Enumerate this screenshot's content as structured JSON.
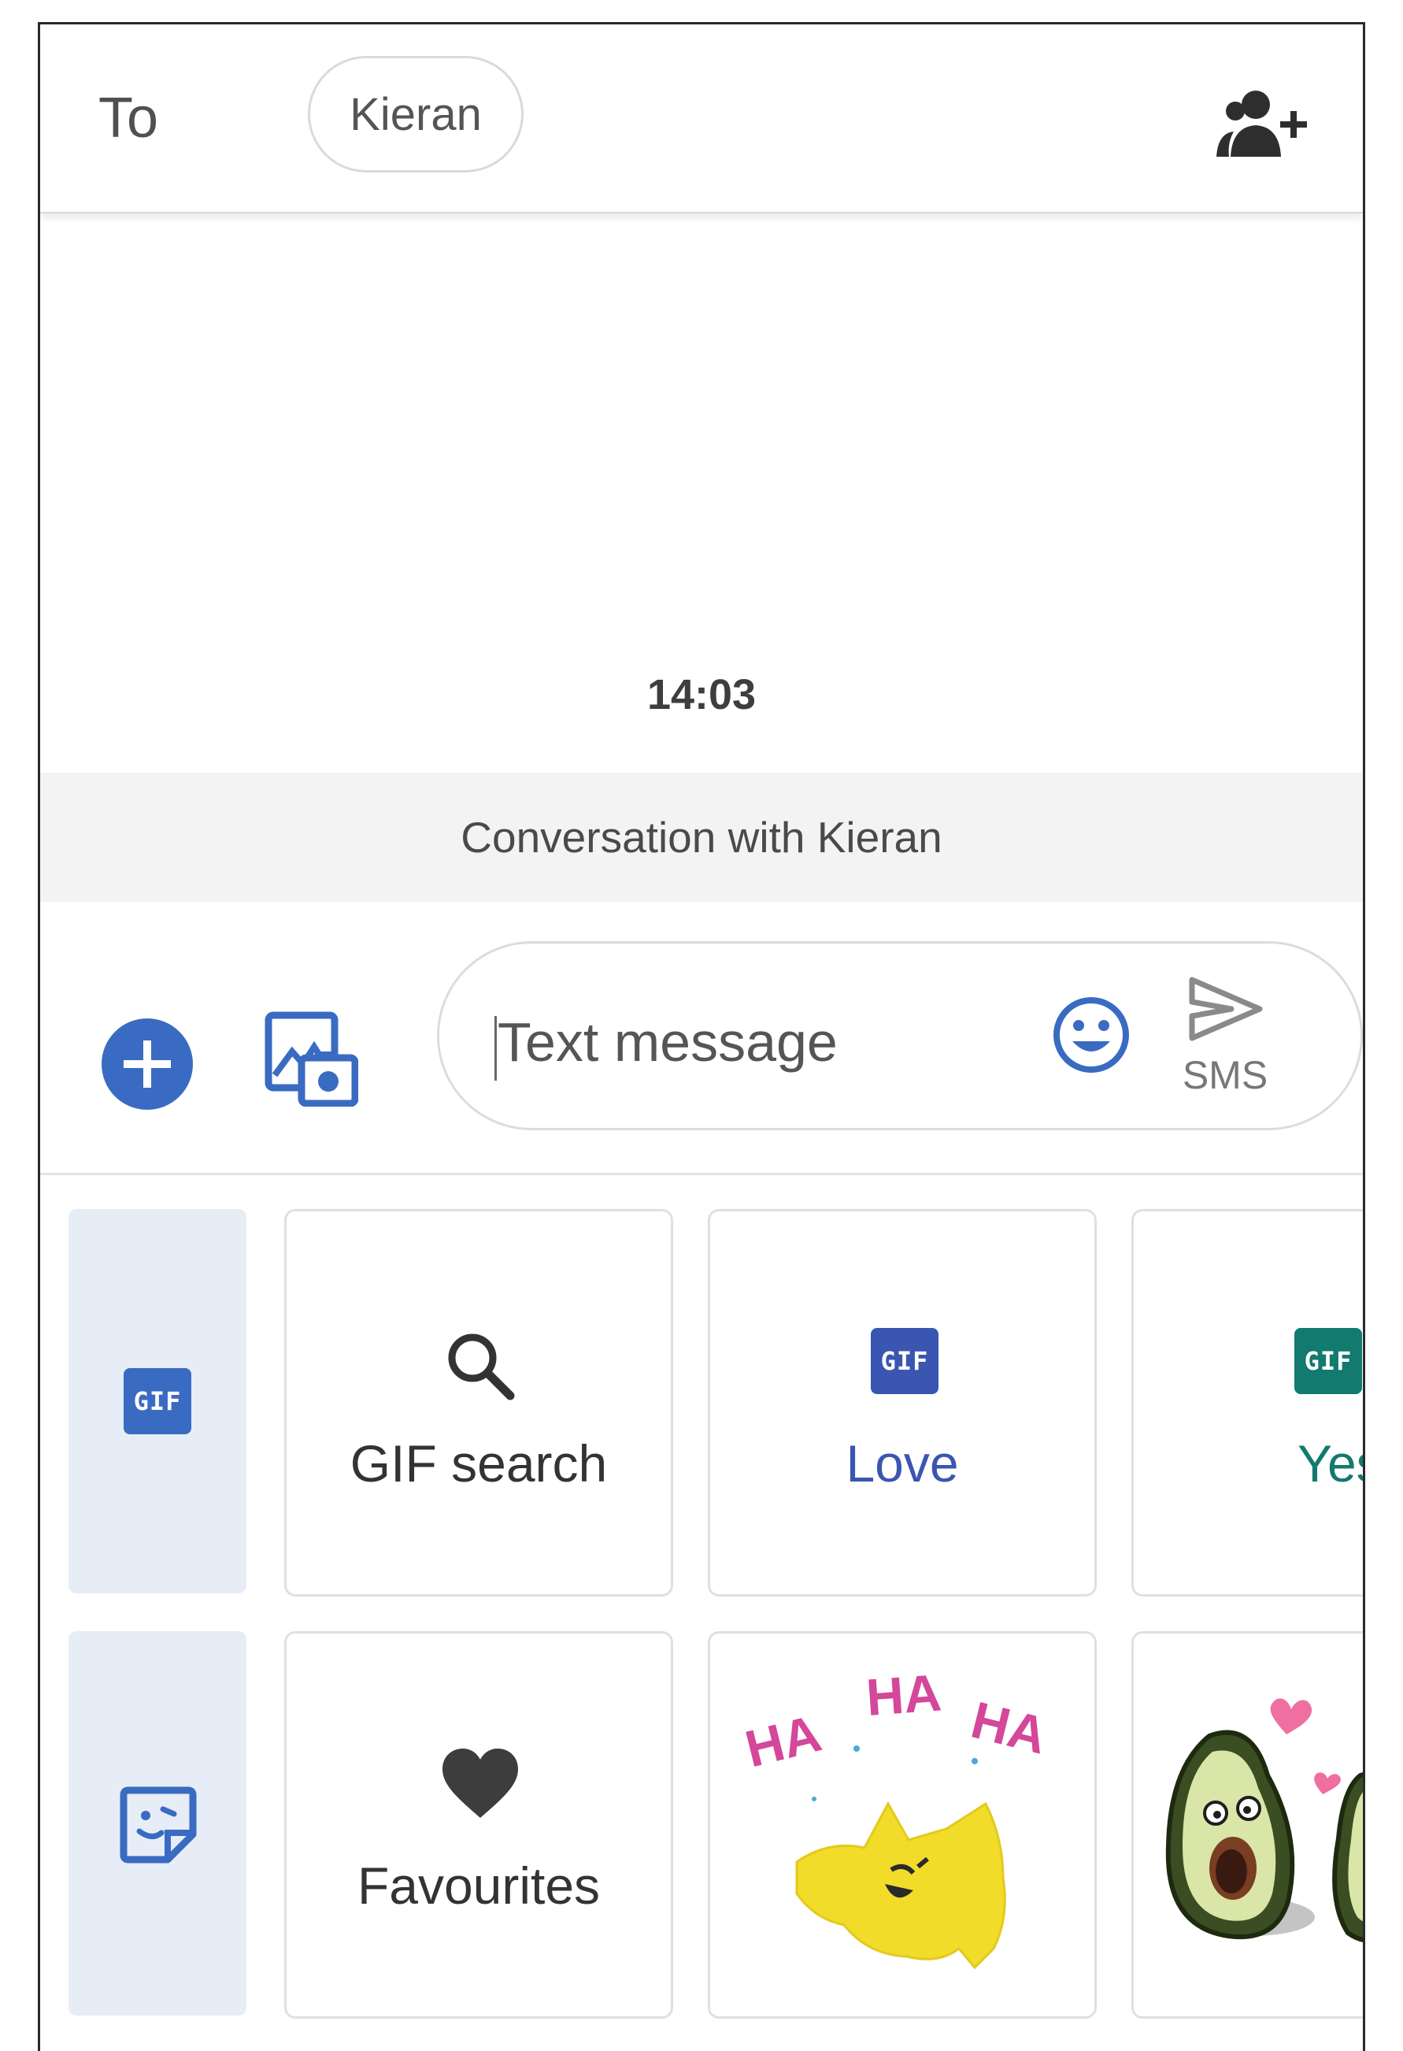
{
  "header": {
    "to_label": "To",
    "recipient": "Kieran",
    "add_contact_icon": "person-add-icon"
  },
  "conversation": {
    "timestamp": "14:03",
    "banner": "Conversation with Kieran"
  },
  "compose": {
    "attach_icon": "plus-circle-icon",
    "media_icon": "gallery-camera-icon",
    "placeholder": "Text message",
    "emoji_icon": "smiley-icon",
    "send_icon": "send-arrow-icon",
    "send_label": "SMS",
    "accent_color": "#3a6bc2"
  },
  "media_panel": {
    "tabs": [
      {
        "name": "gif-tab",
        "icon": "gif-icon",
        "selected": true
      },
      {
        "name": "sticker-tab",
        "icon": "sticker-icon",
        "selected": true
      }
    ],
    "gif_row": [
      {
        "label": "GIF search",
        "icon": "search-icon",
        "color": "#333333"
      },
      {
        "label": "Love",
        "badge": "GIF",
        "color": "#3a56b0"
      },
      {
        "label": "Yes",
        "badge": "GIF",
        "color": "#127a6e"
      }
    ],
    "sticker_row": [
      {
        "label": "Favourites",
        "icon": "heart-icon",
        "color": "#333333"
      },
      {
        "sticker_text": [
          "HA",
          "HA",
          "HA"
        ],
        "sticker": "laughing-yellow-star"
      },
      {
        "sticker": "surprised-avocado-with-hearts"
      }
    ]
  }
}
